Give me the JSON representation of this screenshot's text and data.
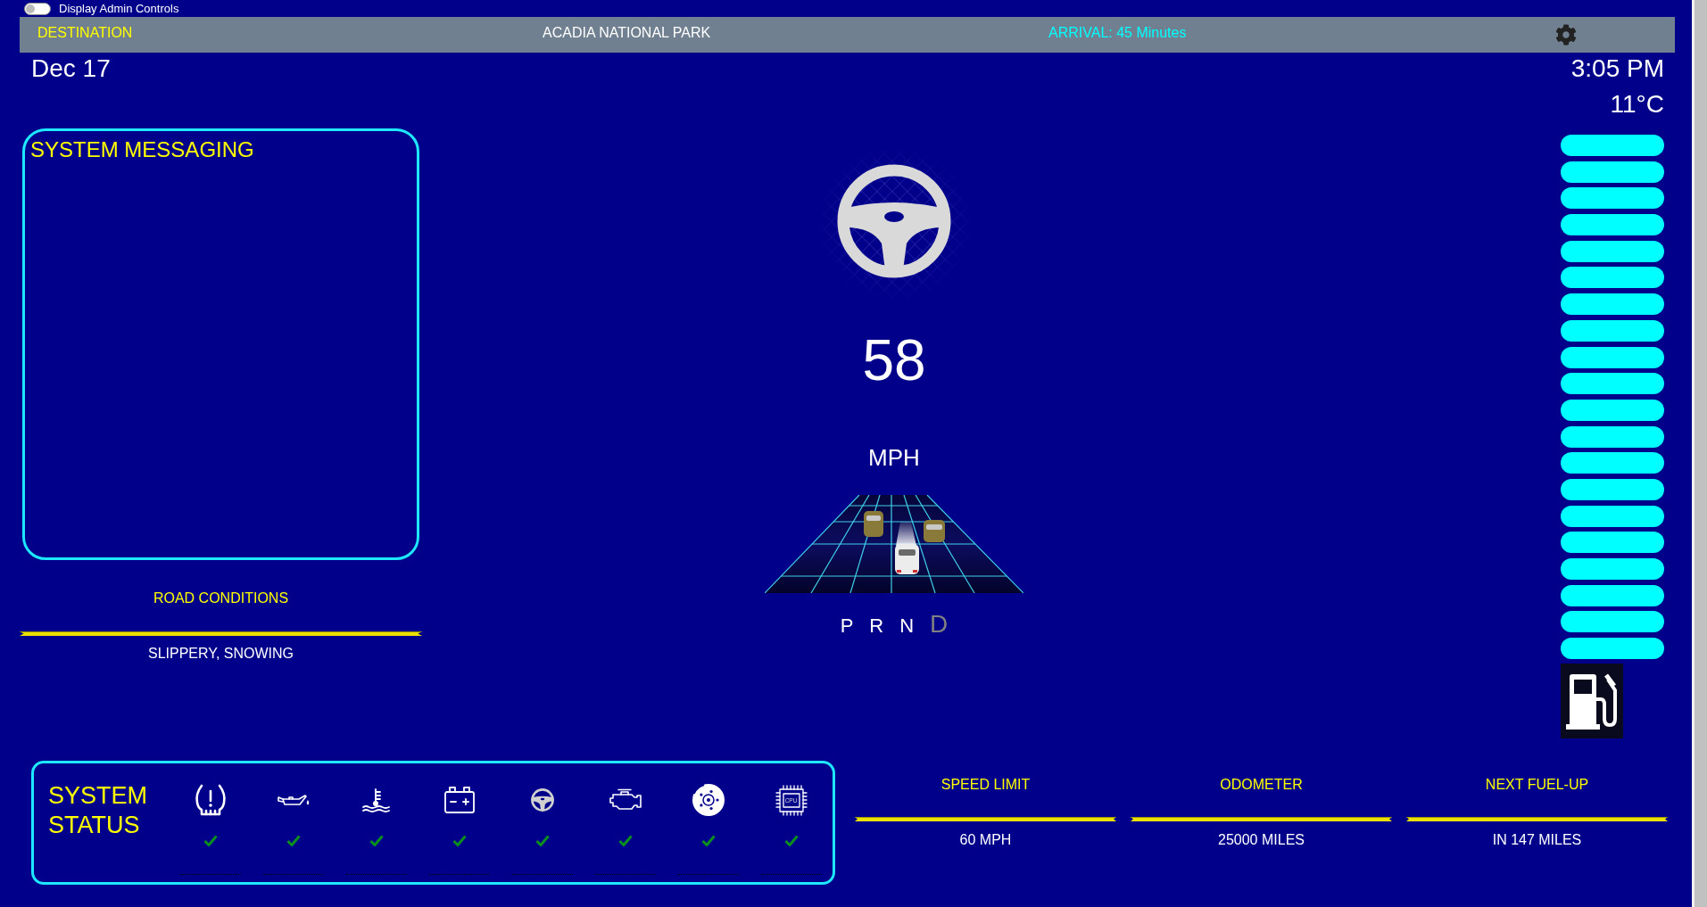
{
  "admin_toggle": {
    "label": "Display Admin Controls",
    "on": false
  },
  "header": {
    "destination_label": "DESTINATION",
    "destination": "ACADIA NATIONAL PARK",
    "arrival": "ARRIVAL: 45 Minutes"
  },
  "date": "Dec 17",
  "time": "3:05 PM",
  "temperature": "11°C",
  "system_messaging": {
    "title": "SYSTEM MESSAGING"
  },
  "road_conditions": {
    "label": "ROAD CONDITIONS",
    "value": "SLIPPERY, SNOWING"
  },
  "speed": {
    "value": "58",
    "unit": "MPH"
  },
  "gears": [
    {
      "label": "P",
      "selected": false
    },
    {
      "label": "R",
      "selected": false
    },
    {
      "label": "N",
      "selected": false
    },
    {
      "label": "D",
      "selected": true
    }
  ],
  "fuel_gauge": {
    "level": 1
  },
  "system_status": {
    "title": "SYSTEM STATUS",
    "items": [
      {
        "kind": "tire",
        "ok": true
      },
      {
        "kind": "oil",
        "ok": true
      },
      {
        "kind": "coolant",
        "ok": true
      },
      {
        "kind": "battery",
        "ok": true
      },
      {
        "kind": "steering",
        "ok": true
      },
      {
        "kind": "engine",
        "ok": true
      },
      {
        "kind": "brake",
        "ok": true
      },
      {
        "kind": "chip",
        "label": "CPU",
        "ok": true
      }
    ]
  },
  "info": [
    {
      "label": "SPEED LIMIT",
      "value": "60 MPH"
    },
    {
      "label": "ODOMETER",
      "value": "25000 MILES"
    },
    {
      "label": "NEXT FUEL-UP",
      "value": "IN 147 MILES"
    }
  ]
}
